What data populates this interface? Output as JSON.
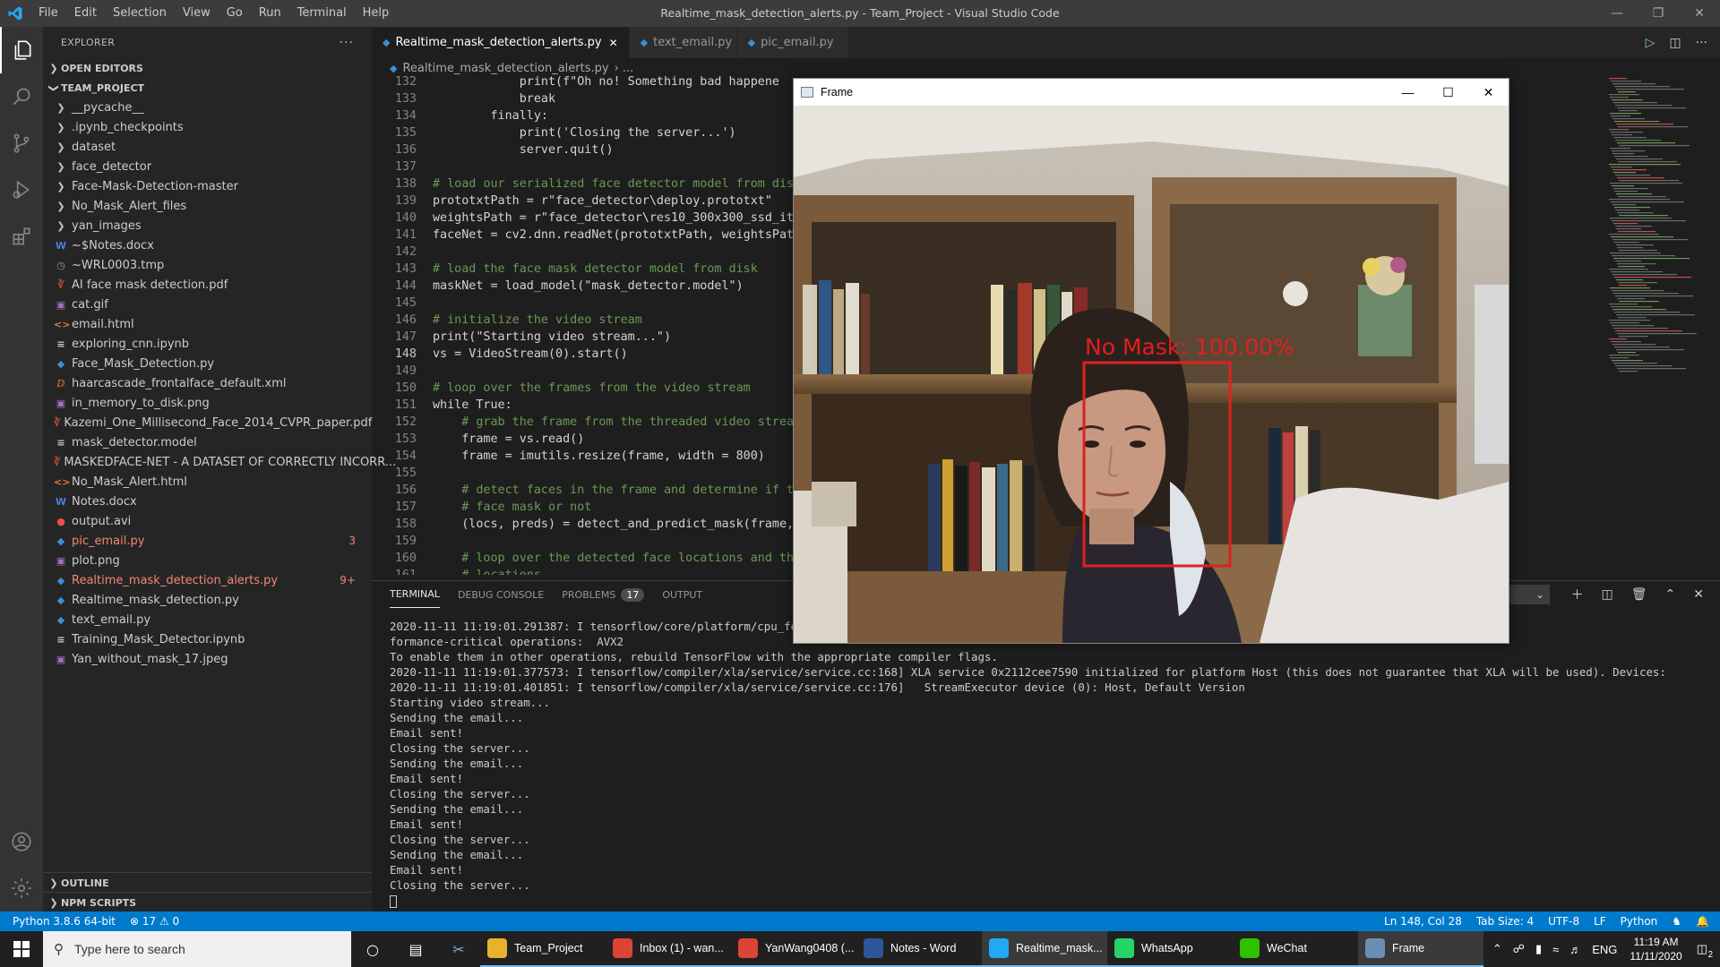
{
  "window": {
    "title": "Realtime_mask_detection_alerts.py - Team_Project - Visual Studio Code",
    "menu": [
      "File",
      "Edit",
      "Selection",
      "View",
      "Go",
      "Run",
      "Terminal",
      "Help"
    ]
  },
  "sidebar": {
    "title": "EXPLORER",
    "open_editors": "OPEN EDITORS",
    "project": "TEAM_PROJECT",
    "outline": "OUTLINE",
    "npm_scripts": "NPM SCRIPTS",
    "items": [
      {
        "label": "__pycache__",
        "type": "folder"
      },
      {
        "label": ".ipynb_checkpoints",
        "type": "folder"
      },
      {
        "label": "dataset",
        "type": "folder"
      },
      {
        "label": "face_detector",
        "type": "folder"
      },
      {
        "label": "Face-Mask-Detection-master",
        "type": "folder"
      },
      {
        "label": "No_Mask_Alert_files",
        "type": "folder"
      },
      {
        "label": "yan_images",
        "type": "folder"
      },
      {
        "label": "~$Notes.docx",
        "type": "docx"
      },
      {
        "label": "~WRL0003.tmp",
        "type": "tmp"
      },
      {
        "label": "AI face mask detection.pdf",
        "type": "pdf"
      },
      {
        "label": "cat.gif",
        "type": "img"
      },
      {
        "label": "email.html",
        "type": "html"
      },
      {
        "label": "exploring_cnn.ipynb",
        "type": "file"
      },
      {
        "label": "Face_Mask_Detection.py",
        "type": "py"
      },
      {
        "label": "haarcascade_frontalface_default.xml",
        "type": "xml"
      },
      {
        "label": "in_memory_to_disk.png",
        "type": "img"
      },
      {
        "label": "Kazemi_One_Millisecond_Face_2014_CVPR_paper.pdf",
        "type": "pdf"
      },
      {
        "label": "mask_detector.model",
        "type": "file"
      },
      {
        "label": "MASKEDFACE-NET - A DATASET OF CORRECTLY INCORR...",
        "type": "pdf"
      },
      {
        "label": "No_Mask_Alert.html",
        "type": "html"
      },
      {
        "label": "Notes.docx",
        "type": "docx"
      },
      {
        "label": "output.avi",
        "type": "avi"
      },
      {
        "label": "pic_email.py",
        "type": "py",
        "badge": "3"
      },
      {
        "label": "plot.png",
        "type": "img"
      },
      {
        "label": "Realtime_mask_detection_alerts.py",
        "type": "py",
        "badge": "9+"
      },
      {
        "label": "Realtime_mask_detection.py",
        "type": "py"
      },
      {
        "label": "text_email.py",
        "type": "py"
      },
      {
        "label": "Training_Mask_Detector.ipynb",
        "type": "file"
      },
      {
        "label": "Yan_without_mask_17.jpeg",
        "type": "img"
      }
    ]
  },
  "tabs": [
    {
      "label": "Realtime_mask_detection_alerts.py",
      "active": true
    },
    {
      "label": "text_email.py",
      "active": false
    },
    {
      "label": "pic_email.py",
      "active": false
    }
  ],
  "breadcrumb": {
    "file": "Realtime_mask_detection_alerts.py",
    "sep": "› ..."
  },
  "code": [
    {
      "n": "132",
      "t": "            print(f\"Oh no! Something bad happene"
    },
    {
      "n": "133",
      "t": "            break"
    },
    {
      "n": "134",
      "t": "        finally:"
    },
    {
      "n": "135",
      "t": "            print('Closing the server...')"
    },
    {
      "n": "136",
      "t": "            server.quit()"
    },
    {
      "n": "137",
      "t": ""
    },
    {
      "n": "138",
      "t": "# load our serialized face detector model from disk"
    },
    {
      "n": "139",
      "t": "prototxtPath = r\"face_detector\\deploy.prototxt\""
    },
    {
      "n": "140",
      "t": "weightsPath = r\"face_detector\\res10_300x300_ssd_iter"
    },
    {
      "n": "141",
      "t": "faceNet = cv2.dnn.readNet(prototxtPath, weightsPath)"
    },
    {
      "n": "142",
      "t": ""
    },
    {
      "n": "143",
      "t": "# load the face mask detector model from disk"
    },
    {
      "n": "144",
      "t": "maskNet = load_model(\"mask_detector.model\")"
    },
    {
      "n": "145",
      "t": ""
    },
    {
      "n": "146",
      "t": "# initialize the video stream"
    },
    {
      "n": "147",
      "t": "print(\"Starting video stream...\")"
    },
    {
      "n": "148",
      "t": "vs = VideoStream(0).start()"
    },
    {
      "n": "149",
      "t": ""
    },
    {
      "n": "150",
      "t": "# loop over the frames from the video stream"
    },
    {
      "n": "151",
      "t": "while True:"
    },
    {
      "n": "152",
      "t": "    # grab the frame from the threaded video stream"
    },
    {
      "n": "153",
      "t": "    frame = vs.read()"
    },
    {
      "n": "154",
      "t": "    frame = imutils.resize(frame, width = 800)"
    },
    {
      "n": "155",
      "t": ""
    },
    {
      "n": "156",
      "t": "    # detect faces in the frame and determine if the"
    },
    {
      "n": "157",
      "t": "    # face mask or not"
    },
    {
      "n": "158",
      "t": "    (locs, preds) = detect_and_predict_mask(frame, f"
    },
    {
      "n": "159",
      "t": ""
    },
    {
      "n": "160",
      "t": "    # loop over the detected face locations and thei"
    },
    {
      "n": "161",
      "t": "    # locations"
    }
  ],
  "panel": {
    "tabs": [
      "TERMINAL",
      "DEBUG CONSOLE",
      "PROBLEMS",
      "OUTPUT"
    ],
    "problems_count": "17",
    "terminal_lines": [
      "2020-11-11 11:19:01.291387: I tensorflow/core/platform/cpu_featu                                                                       llowing CPU instructions in per",
      "formance-critical operations:  AVX2",
      "To enable them in other operations, rebuild TensorFlow with the appropriate compiler flags.",
      "2020-11-11 11:19:01.377573: I tensorflow/compiler/xla/service/service.cc:168] XLA service 0x2112cee7590 initialized for platform Host (this does not guarantee that XLA will be used). Devices:",
      "2020-11-11 11:19:01.401851: I tensorflow/compiler/xla/service/service.cc:176]   StreamExecutor device (0): Host, Default Version",
      "Starting video stream...",
      "Sending the email...",
      "Email sent!",
      "Closing the server...",
      "Sending the email...",
      "Email sent!",
      "Closing the server...",
      "Sending the email...",
      "Email sent!",
      "Closing the server...",
      "Sending the email...",
      "Email sent!",
      "Closing the server..."
    ]
  },
  "statusbar": {
    "python": "Python 3.8.6 64-bit",
    "problems": "⊗ 17 ⚠ 0",
    "position": "Ln 148, Col 28",
    "tabsize": "Tab Size: 4",
    "encoding": "UTF-8",
    "eol": "LF",
    "language": "Python"
  },
  "frame_window": {
    "title": "Frame",
    "detection_label": "No Mask: 100.00%"
  },
  "taskbar": {
    "search_placeholder": "Type here to search",
    "apps": [
      {
        "label": "Team_Project",
        "color": "#e8b32c",
        "icon": "folder-icon"
      },
      {
        "label": "Inbox (1) - wan...",
        "color": "#db4437",
        "icon": "chrome-icon"
      },
      {
        "label": "YanWang0408 (...",
        "color": "#db4437",
        "icon": "chrome-icon"
      },
      {
        "label": "Notes - Word",
        "color": "#2b579a",
        "icon": "word-icon"
      },
      {
        "label": "Realtime_mask...",
        "color": "#23a9f2",
        "icon": "vscode-icon",
        "active": true
      },
      {
        "label": "WhatsApp",
        "color": "#25d366",
        "icon": "whatsapp-icon"
      },
      {
        "label": "WeChat",
        "color": "#2dc100",
        "icon": "wechat-icon"
      },
      {
        "label": "Frame",
        "color": "#6a8fb5",
        "icon": "frame-icon",
        "active": true
      }
    ],
    "lang": "ENG",
    "time": "11:19 AM",
    "date": "11/11/2020",
    "notification_count": "2"
  },
  "colors": {
    "accent": "#007acc",
    "error": "#f48771",
    "detection_box": "#e02020"
  }
}
